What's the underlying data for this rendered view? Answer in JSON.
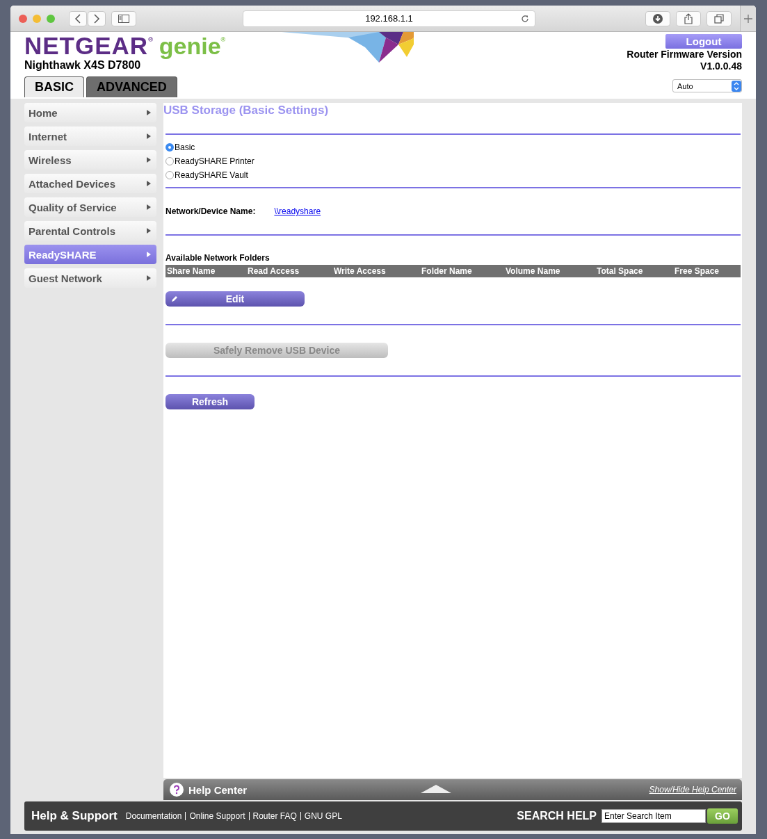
{
  "browser": {
    "address": "192.168.1.1"
  },
  "header": {
    "logo": "NETGEAR$^{®}$",
    "product": "genie$^{®}$",
    "model": "Nighthawk X4S D7800",
    "logout": "Logout",
    "firmware_label": "Router Firmware Version",
    "firmware_version": "V1.0.0.48",
    "language": "Auto"
  },
  "tabs": [
    {
      "label": "BASIC",
      "selected": true
    },
    {
      "label": "ADVANCED",
      "selected": false
    }
  ],
  "sidebar": {
    "items": [
      {
        "label": "Home",
        "selected": false
      },
      {
        "label": "Internet",
        "selected": false
      },
      {
        "label": "Wireless",
        "selected": false
      },
      {
        "label": "Attached Devices",
        "selected": false
      },
      {
        "label": "Quality of Service",
        "selected": false
      },
      {
        "label": "Parental Controls",
        "selected": false
      },
      {
        "label": "ReadySHARE",
        "selected": true
      },
      {
        "label": "Guest Network",
        "selected": false
      }
    ]
  },
  "page": {
    "title": "USB Storage (Basic Settings)",
    "modes": [
      {
        "label": "Basic",
        "selected": true
      },
      {
        "label": "ReadySHARE Printer",
        "selected": false
      },
      {
        "label": "ReadySHARE Vault",
        "selected": false
      }
    ],
    "device_name_label": "Network/Device Name:",
    "device_name": "\\\\readyshare",
    "folders_title": "Available Network Folders",
    "columns": [
      "Share Name",
      "Read Access",
      "Write Access",
      "Folder Name",
      "Volume Name",
      "Total Space",
      "Free Space"
    ],
    "edit_button": "Edit",
    "remove_button": {
      "label": "Safely Remove USB Device",
      "disabled": true
    },
    "refresh_button": "Refresh"
  },
  "help_center": {
    "title": "Help Center",
    "toggle": "Show/Hide Help Center"
  },
  "footer": {
    "title": "Help & Support",
    "links": [
      "Documentation",
      "Online Support",
      "Router FAQ",
      "GNU GPL"
    ],
    "search_label": "SEARCH HELP",
    "search_placeholder": "Enter Search Item",
    "go": "GO"
  }
}
